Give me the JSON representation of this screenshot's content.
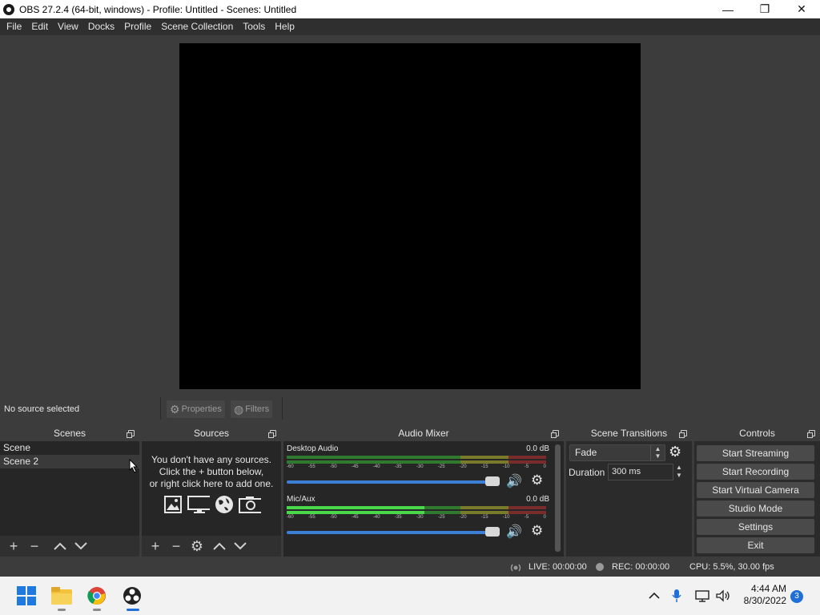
{
  "window": {
    "title": "OBS 27.2.4 (64-bit, windows) - Profile: Untitled - Scenes: Untitled",
    "controls": {
      "minimize": "—",
      "maximize": "❐",
      "close": "✕"
    }
  },
  "menu": [
    "File",
    "Edit",
    "View",
    "Docks",
    "Profile",
    "Scene Collection",
    "Tools",
    "Help"
  ],
  "source_toolbar": {
    "status": "No source selected",
    "properties": "Properties",
    "filters": "Filters"
  },
  "scenes": {
    "title": "Scenes",
    "items": [
      "Scene",
      "Scene 2"
    ]
  },
  "sources": {
    "title": "Sources",
    "empty_lines": [
      "You don't have any sources.",
      "Click the + button below,",
      "or right click here to add one."
    ]
  },
  "mixer": {
    "title": "Audio Mixer",
    "ticks": [
      "-60",
      "-55",
      "-50",
      "-45",
      "-40",
      "-35",
      "-30",
      "-25",
      "-20",
      "-15",
      "-10",
      "-5",
      "0"
    ],
    "channels": [
      {
        "name": "Desktop Audio",
        "db": "0.0 dB",
        "level": 0
      },
      {
        "name": "Mic/Aux",
        "db": "0.0 dB",
        "level": 0.53
      }
    ]
  },
  "transitions": {
    "title": "Scene Transitions",
    "selected": "Fade",
    "duration_label": "Duration",
    "duration_value": "300 ms"
  },
  "controls": {
    "title": "Controls",
    "buttons": [
      "Start Streaming",
      "Start Recording",
      "Start Virtual Camera",
      "Studio Mode",
      "Settings",
      "Exit"
    ]
  },
  "status": {
    "live": "LIVE: 00:00:00",
    "rec": "REC: 00:00:00",
    "cpu": "CPU: 5.5%, 30.00 fps"
  },
  "taskbar": {
    "time": "4:44 AM",
    "date": "8/30/2022",
    "notifications": "3"
  }
}
